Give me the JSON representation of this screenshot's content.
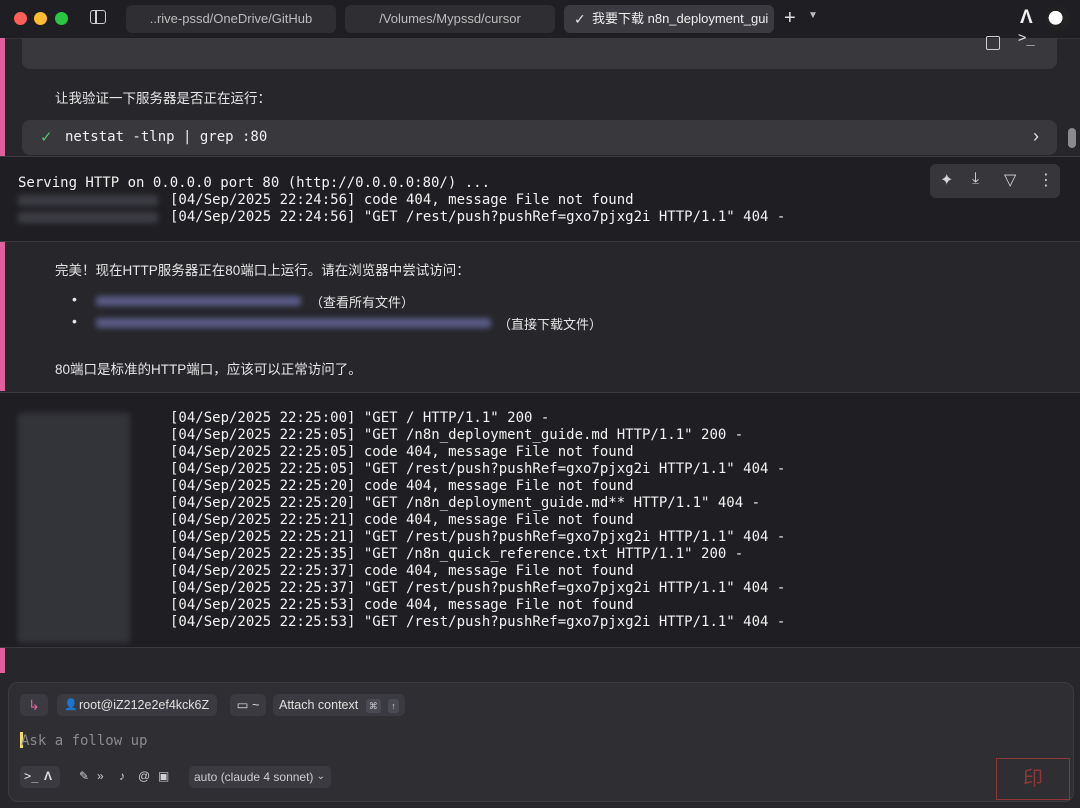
{
  "tabs": [
    {
      "label": "..rive-pssd/OneDrive/GitHub"
    },
    {
      "label": "/Volumes/Mypssd/cursor"
    },
    {
      "label": "我要下载 n8n_deployment_gui",
      "active": true
    }
  ],
  "messages": {
    "verify": "让我验证一下服务器是否正在运行：",
    "perfect": "完美！现在HTTP服务器正在80端口上运行。请在浏览器中尝试访问：",
    "url_note_1": "（查看所有文件）",
    "url_note_2": "（直接下载文件）",
    "port_note": "80端口是标准的HTTP端口，应该可以正常访问了。"
  },
  "command": {
    "text": "netstat -tlnp | grep :80",
    "status": "success"
  },
  "output1": {
    "lines": [
      "Serving HTTP on 0.0.0.0 port 80 (http://0.0.0.0:80/) ...",
      "[04/Sep/2025 22:24:56] code 404, message File not found",
      "[04/Sep/2025 22:24:56] \"GET /rest/push?pushRef=gxo7pjxg2i HTTP/1.1\" 404 -"
    ]
  },
  "output2": {
    "lines": [
      "[04/Sep/2025 22:25:00] \"GET / HTTP/1.1\" 200 -",
      "[04/Sep/2025 22:25:05] \"GET /n8n_deployment_guide.md HTTP/1.1\" 200 -",
      "[04/Sep/2025 22:25:05] code 404, message File not found",
      "[04/Sep/2025 22:25:05] \"GET /rest/push?pushRef=gxo7pjxg2i HTTP/1.1\" 404 -",
      "[04/Sep/2025 22:25:20] code 404, message File not found",
      "[04/Sep/2025 22:25:20] \"GET /n8n_deployment_guide.md** HTTP/1.1\" 404 -",
      "[04/Sep/2025 22:25:21] code 404, message File not found",
      "[04/Sep/2025 22:25:21] \"GET /rest/push?pushRef=gxo7pjxg2i HTTP/1.1\" 404 -",
      "[04/Sep/2025 22:25:35] \"GET /n8n_quick_reference.txt HTTP/1.1\" 200 -",
      "[04/Sep/2025 22:25:37] code 404, message File not found",
      "[04/Sep/2025 22:25:37] \"GET /rest/push?pushRef=gxo7pjxg2i HTTP/1.1\" 404 -",
      "[04/Sep/2025 22:25:53] code 404, message File not found",
      "[04/Sep/2025 22:25:53] \"GET /rest/push?pushRef=gxo7pjxg2i HTTP/1.1\" 404 -"
    ]
  },
  "input": {
    "user_chip": "root@iZ212e2ef4kck6Z",
    "folder_chip": "~",
    "attach_label": "Attach context",
    "attach_kbd_1": "⌘",
    "attach_kbd_2": "↑",
    "placeholder": "Ask a follow up",
    "model": "auto (claude 4 sonnet)"
  },
  "icons": {
    "copy": "copy-icon",
    "terminal": "terminal-icon",
    "sparkle": "sparkle-icon",
    "download": "download-icon",
    "filter": "filter-icon",
    "more": "more-icon"
  },
  "colors": {
    "accent": "#e0609b",
    "success": "#56c271",
    "background": "#26262b"
  }
}
